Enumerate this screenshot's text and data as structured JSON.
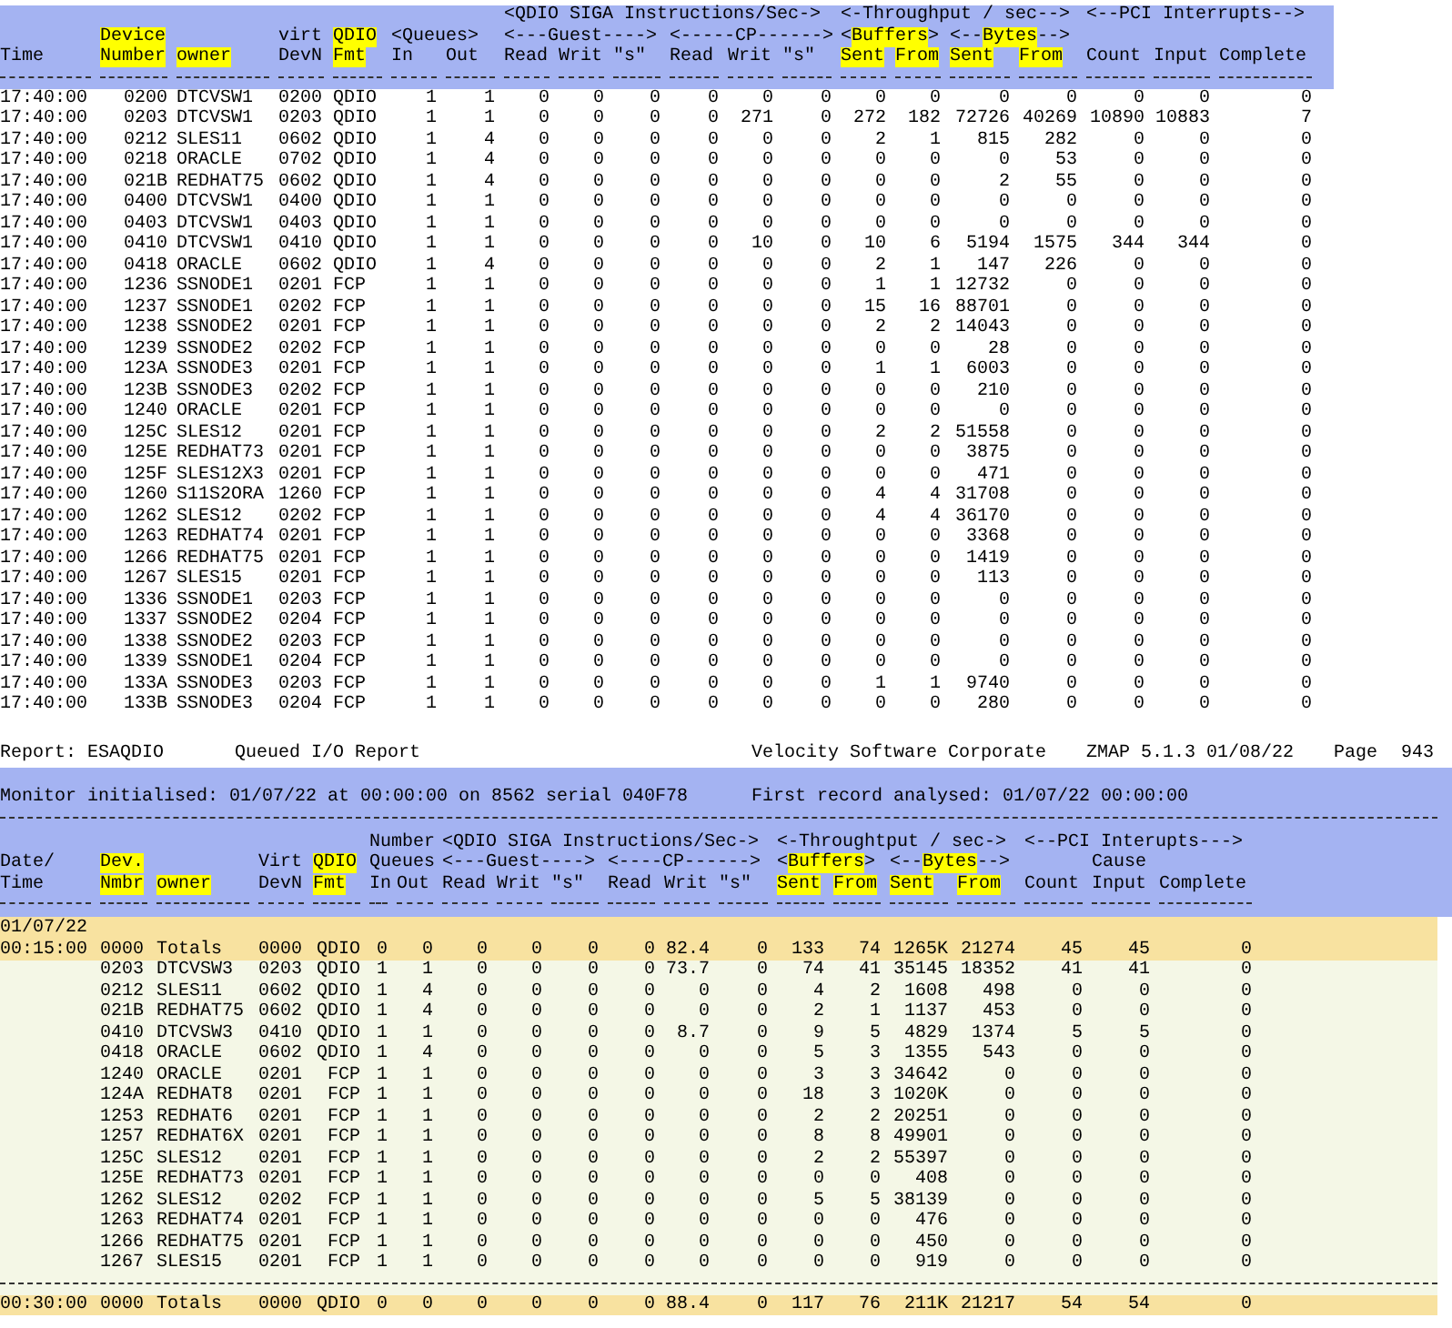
{
  "top_table": {
    "header_rows": [
      [
        {
          "text": "<QDIO SIGA Instructions/Sec->",
          "highlight": false
        },
        {
          "text": "<-Throughput / sec-->",
          "highlight": false
        },
        {
          "text": "<--PCI Interrupts-->",
          "highlight": false
        }
      ],
      [
        {
          "text": "Device",
          "highlight": true
        },
        {
          "text": "virt",
          "highlight": false
        },
        {
          "text": "QDIO",
          "highlight": true
        },
        {
          "text": "<Queues>",
          "highlight": false
        },
        {
          "text": "<---Guest---->",
          "highlight": false
        },
        {
          "text": "<-----CP------>",
          "highlight": false
        },
        {
          "parts": [
            {
              "text": "<",
              "highlight": false
            },
            {
              "text": "Buffers",
              "highlight": true
            },
            {
              "text": ">",
              "highlight": false
            }
          ]
        },
        {
          "parts": [
            {
              "text": "<--",
              "highlight": false
            },
            {
              "text": "Bytes",
              "highlight": true
            },
            {
              "text": "-->",
              "highlight": false
            }
          ]
        }
      ],
      [
        {
          "text": "Time",
          "highlight": false
        },
        {
          "text": "Number",
          "highlight": true
        },
        {
          "text": "owner",
          "highlight": true
        },
        {
          "text": "DevN",
          "highlight": false
        },
        {
          "text": "Fmt",
          "highlight": true
        },
        {
          "text": "In",
          "highlight": false
        },
        {
          "text": "Out",
          "highlight": false
        },
        {
          "text": "Read",
          "highlight": false
        },
        {
          "text": "Writ",
          "highlight": false
        },
        {
          "text": "\"s\"",
          "highlight": false
        },
        {
          "text": "Read",
          "highlight": false
        },
        {
          "text": "Writ",
          "highlight": false
        },
        {
          "text": "\"s\"",
          "highlight": false
        },
        {
          "text": "Sent",
          "highlight": true
        },
        {
          "text": "From",
          "highlight": true
        },
        {
          "text": "Sent",
          "highlight": true
        },
        {
          "text": "From",
          "highlight": true
        },
        {
          "text": "Count",
          "highlight": false
        },
        {
          "text": "Input",
          "highlight": false
        },
        {
          "text": "Complete",
          "highlight": false
        }
      ]
    ],
    "rows": [
      [
        "17:40:00",
        "0200",
        "DTCVSW1",
        "0200",
        "QDIO",
        "1",
        "1",
        "0",
        "0",
        "0",
        "0",
        "0",
        "0",
        "0",
        "0",
        "0",
        "0",
        "0",
        "0",
        "0"
      ],
      [
        "17:40:00",
        "0203",
        "DTCVSW1",
        "0203",
        "QDIO",
        "1",
        "1",
        "0",
        "0",
        "0",
        "0",
        "271",
        "0",
        "272",
        "182",
        "72726",
        "40269",
        "10890",
        "10883",
        "7"
      ],
      [
        "17:40:00",
        "0212",
        "SLES11",
        "0602",
        "QDIO",
        "1",
        "4",
        "0",
        "0",
        "0",
        "0",
        "0",
        "0",
        "2",
        "1",
        "815",
        "282",
        "0",
        "0",
        "0"
      ],
      [
        "17:40:00",
        "0218",
        "ORACLE",
        "0702",
        "QDIO",
        "1",
        "4",
        "0",
        "0",
        "0",
        "0",
        "0",
        "0",
        "0",
        "0",
        "0",
        "53",
        "0",
        "0",
        "0"
      ],
      [
        "17:40:00",
        "021B",
        "REDHAT75",
        "0602",
        "QDIO",
        "1",
        "4",
        "0",
        "0",
        "0",
        "0",
        "0",
        "0",
        "0",
        "0",
        "2",
        "55",
        "0",
        "0",
        "0"
      ],
      [
        "17:40:00",
        "0400",
        "DTCVSW1",
        "0400",
        "QDIO",
        "1",
        "1",
        "0",
        "0",
        "0",
        "0",
        "0",
        "0",
        "0",
        "0",
        "0",
        "0",
        "0",
        "0",
        "0"
      ],
      [
        "17:40:00",
        "0403",
        "DTCVSW1",
        "0403",
        "QDIO",
        "1",
        "1",
        "0",
        "0",
        "0",
        "0",
        "0",
        "0",
        "0",
        "0",
        "0",
        "0",
        "0",
        "0",
        "0"
      ],
      [
        "17:40:00",
        "0410",
        "DTCVSW1",
        "0410",
        "QDIO",
        "1",
        "1",
        "0",
        "0",
        "0",
        "0",
        "10",
        "0",
        "10",
        "6",
        "5194",
        "1575",
        "344",
        "344",
        "0"
      ],
      [
        "17:40:00",
        "0418",
        "ORACLE",
        "0602",
        "QDIO",
        "1",
        "4",
        "0",
        "0",
        "0",
        "0",
        "0",
        "0",
        "2",
        "1",
        "147",
        "226",
        "0",
        "0",
        "0"
      ],
      [
        "17:40:00",
        "1236",
        "SSNODE1",
        "0201",
        "FCP",
        "1",
        "1",
        "0",
        "0",
        "0",
        "0",
        "0",
        "0",
        "1",
        "1",
        "12732",
        "0",
        "0",
        "0",
        "0"
      ],
      [
        "17:40:00",
        "1237",
        "SSNODE1",
        "0202",
        "FCP",
        "1",
        "1",
        "0",
        "0",
        "0",
        "0",
        "0",
        "0",
        "15",
        "16",
        "88701",
        "0",
        "0",
        "0",
        "0"
      ],
      [
        "17:40:00",
        "1238",
        "SSNODE2",
        "0201",
        "FCP",
        "1",
        "1",
        "0",
        "0",
        "0",
        "0",
        "0",
        "0",
        "2",
        "2",
        "14043",
        "0",
        "0",
        "0",
        "0"
      ],
      [
        "17:40:00",
        "1239",
        "SSNODE2",
        "0202",
        "FCP",
        "1",
        "1",
        "0",
        "0",
        "0",
        "0",
        "0",
        "0",
        "0",
        "0",
        "28",
        "0",
        "0",
        "0",
        "0"
      ],
      [
        "17:40:00",
        "123A",
        "SSNODE3",
        "0201",
        "FCP",
        "1",
        "1",
        "0",
        "0",
        "0",
        "0",
        "0",
        "0",
        "1",
        "1",
        "6003",
        "0",
        "0",
        "0",
        "0"
      ],
      [
        "17:40:00",
        "123B",
        "SSNODE3",
        "0202",
        "FCP",
        "1",
        "1",
        "0",
        "0",
        "0",
        "0",
        "0",
        "0",
        "0",
        "0",
        "210",
        "0",
        "0",
        "0",
        "0"
      ],
      [
        "17:40:00",
        "1240",
        "ORACLE",
        "0201",
        "FCP",
        "1",
        "1",
        "0",
        "0",
        "0",
        "0",
        "0",
        "0",
        "0",
        "0",
        "0",
        "0",
        "0",
        "0",
        "0"
      ],
      [
        "17:40:00",
        "125C",
        "SLES12",
        "0201",
        "FCP",
        "1",
        "1",
        "0",
        "0",
        "0",
        "0",
        "0",
        "0",
        "2",
        "2",
        "51558",
        "0",
        "0",
        "0",
        "0"
      ],
      [
        "17:40:00",
        "125E",
        "REDHAT73",
        "0201",
        "FCP",
        "1",
        "1",
        "0",
        "0",
        "0",
        "0",
        "0",
        "0",
        "0",
        "0",
        "3875",
        "0",
        "0",
        "0",
        "0"
      ],
      [
        "17:40:00",
        "125F",
        "SLES12X3",
        "0201",
        "FCP",
        "1",
        "1",
        "0",
        "0",
        "0",
        "0",
        "0",
        "0",
        "0",
        "0",
        "471",
        "0",
        "0",
        "0",
        "0"
      ],
      [
        "17:40:00",
        "1260",
        "S11S2ORA",
        "1260",
        "FCP",
        "1",
        "1",
        "0",
        "0",
        "0",
        "0",
        "0",
        "0",
        "4",
        "4",
        "31708",
        "0",
        "0",
        "0",
        "0"
      ],
      [
        "17:40:00",
        "1262",
        "SLES12",
        "0202",
        "FCP",
        "1",
        "1",
        "0",
        "0",
        "0",
        "0",
        "0",
        "0",
        "4",
        "4",
        "36170",
        "0",
        "0",
        "0",
        "0"
      ],
      [
        "17:40:00",
        "1263",
        "REDHAT74",
        "0201",
        "FCP",
        "1",
        "1",
        "0",
        "0",
        "0",
        "0",
        "0",
        "0",
        "0",
        "0",
        "3368",
        "0",
        "0",
        "0",
        "0"
      ],
      [
        "17:40:00",
        "1266",
        "REDHAT75",
        "0201",
        "FCP",
        "1",
        "1",
        "0",
        "0",
        "0",
        "0",
        "0",
        "0",
        "0",
        "0",
        "1419",
        "0",
        "0",
        "0",
        "0"
      ],
      [
        "17:40:00",
        "1267",
        "SLES15",
        "0201",
        "FCP",
        "1",
        "1",
        "0",
        "0",
        "0",
        "0",
        "0",
        "0",
        "0",
        "0",
        "113",
        "0",
        "0",
        "0",
        "0"
      ],
      [
        "17:40:00",
        "1336",
        "SSNODE1",
        "0203",
        "FCP",
        "1",
        "1",
        "0",
        "0",
        "0",
        "0",
        "0",
        "0",
        "0",
        "0",
        "0",
        "0",
        "0",
        "0",
        "0"
      ],
      [
        "17:40:00",
        "1337",
        "SSNODE2",
        "0204",
        "FCP",
        "1",
        "1",
        "0",
        "0",
        "0",
        "0",
        "0",
        "0",
        "0",
        "0",
        "0",
        "0",
        "0",
        "0",
        "0"
      ],
      [
        "17:40:00",
        "1338",
        "SSNODE2",
        "0203",
        "FCP",
        "1",
        "1",
        "0",
        "0",
        "0",
        "0",
        "0",
        "0",
        "0",
        "0",
        "0",
        "0",
        "0",
        "0",
        "0"
      ],
      [
        "17:40:00",
        "1339",
        "SSNODE1",
        "0204",
        "FCP",
        "1",
        "1",
        "0",
        "0",
        "0",
        "0",
        "0",
        "0",
        "0",
        "0",
        "0",
        "0",
        "0",
        "0",
        "0"
      ],
      [
        "17:40:00",
        "133A",
        "SSNODE3",
        "0203",
        "FCP",
        "1",
        "1",
        "0",
        "0",
        "0",
        "0",
        "0",
        "0",
        "1",
        "1",
        "9740",
        "0",
        "0",
        "0",
        "0"
      ],
      [
        "17:40:00",
        "133B",
        "SSNODE3",
        "0204",
        "FCP",
        "1",
        "1",
        "0",
        "0",
        "0",
        "0",
        "0",
        "0",
        "0",
        "0",
        "280",
        "0",
        "0",
        "0",
        "0"
      ]
    ]
  },
  "report_line": {
    "report": "Report: ESAQDIO",
    "title": "Queued I/O Report",
    "company": "Velocity Software Corporate",
    "version": "ZMAP 5.1.3 01/08/22",
    "page_label": "Page",
    "page": "943"
  },
  "bottom_table": {
    "monitor": "Monitor initialised: 01/07/22 at 00:00:00 on 8562 serial 040F78",
    "first_record": "First record analysed: 01/07/22 00:00:00",
    "header_rows": [
      [
        {
          "text": "Number",
          "highlight": false
        },
        {
          "text": "<QDIO SIGA Instructions/Sec->",
          "highlight": false
        },
        {
          "text": "<-Throughtput / sec->",
          "highlight": false
        },
        {
          "text": "<--PCI Interupts--->",
          "highlight": false
        }
      ],
      [
        {
          "text": "Date/",
          "highlight": false
        },
        {
          "text": "Dev.",
          "highlight": true
        },
        {
          "text": "Virt",
          "highlight": false
        },
        {
          "text": "QDIO",
          "highlight": true
        },
        {
          "text": "Queues",
          "highlight": false
        },
        {
          "text": "<---Guest---->",
          "highlight": false
        },
        {
          "text": "<----CP------>",
          "highlight": false
        },
        {
          "parts": [
            {
              "text": "<",
              "highlight": false
            },
            {
              "text": "Buffers",
              "highlight": true
            },
            {
              "text": ">",
              "highlight": false
            }
          ]
        },
        {
          "parts": [
            {
              "text": "<--",
              "highlight": false
            },
            {
              "text": "Bytes",
              "highlight": true
            },
            {
              "text": "-->",
              "highlight": false
            }
          ]
        },
        {
          "text": "Cause",
          "highlight": false
        }
      ],
      [
        {
          "text": "Time",
          "highlight": false
        },
        {
          "text": "Nmbr",
          "highlight": true
        },
        {
          "text": "owner",
          "highlight": true
        },
        {
          "text": "DevN",
          "highlight": false
        },
        {
          "text": "Fmt",
          "highlight": true
        },
        {
          "text": "In",
          "highlight": false
        },
        {
          "text": "Out",
          "highlight": false
        },
        {
          "text": "Read",
          "highlight": false
        },
        {
          "text": "Writ",
          "highlight": false
        },
        {
          "text": "\"s\"",
          "highlight": false
        },
        {
          "text": "Read",
          "highlight": false
        },
        {
          "text": "Writ",
          "highlight": false
        },
        {
          "text": "\"s\"",
          "highlight": false
        },
        {
          "text": "Sent",
          "highlight": true
        },
        {
          "text": "From",
          "highlight": true
        },
        {
          "text": "Sent",
          "highlight": true
        },
        {
          "text": "From",
          "highlight": true
        },
        {
          "text": "Count",
          "highlight": false
        },
        {
          "text": "Input",
          "highlight": false
        },
        {
          "text": "Complete",
          "highlight": false
        }
      ]
    ],
    "rows": [
      {
        "kind": "date",
        "date": "01/07/22"
      },
      {
        "kind": "total",
        "time": "00:15:00",
        "cells": [
          "0000",
          "Totals",
          "0000",
          "QDIO",
          "0",
          "0",
          "0",
          "0",
          "0",
          "0",
          "82.4",
          "0",
          "133",
          "74",
          "1265K",
          "21274",
          "45",
          "45",
          "0"
        ]
      },
      {
        "kind": "detail",
        "cells": [
          "0203",
          "DTCVSW3",
          "0203",
          "QDIO",
          "1",
          "1",
          "0",
          "0",
          "0",
          "0",
          "73.7",
          "0",
          "74",
          "41",
          "35145",
          "18352",
          "41",
          "41",
          "0"
        ]
      },
      {
        "kind": "detail",
        "cells": [
          "0212",
          "SLES11",
          "0602",
          "QDIO",
          "1",
          "4",
          "0",
          "0",
          "0",
          "0",
          "0",
          "0",
          "4",
          "2",
          "1608",
          "498",
          "0",
          "0",
          "0"
        ]
      },
      {
        "kind": "detail",
        "cells": [
          "021B",
          "REDHAT75",
          "0602",
          "QDIO",
          "1",
          "4",
          "0",
          "0",
          "0",
          "0",
          "0",
          "0",
          "2",
          "1",
          "1137",
          "453",
          "0",
          "0",
          "0"
        ]
      },
      {
        "kind": "detail",
        "cells": [
          "0410",
          "DTCVSW3",
          "0410",
          "QDIO",
          "1",
          "1",
          "0",
          "0",
          "0",
          "0",
          "8.7",
          "0",
          "9",
          "5",
          "4829",
          "1374",
          "5",
          "5",
          "0"
        ]
      },
      {
        "kind": "detail",
        "cells": [
          "0418",
          "ORACLE",
          "0602",
          "QDIO",
          "1",
          "4",
          "0",
          "0",
          "0",
          "0",
          "0",
          "0",
          "5",
          "3",
          "1355",
          "543",
          "0",
          "0",
          "0"
        ]
      },
      {
        "kind": "detail",
        "cells": [
          "1240",
          "ORACLE",
          "0201",
          "FCP",
          "1",
          "1",
          "0",
          "0",
          "0",
          "0",
          "0",
          "0",
          "3",
          "3",
          "34642",
          "0",
          "0",
          "0",
          "0"
        ]
      },
      {
        "kind": "detail",
        "cells": [
          "124A",
          "REDHAT8",
          "0201",
          "FCP",
          "1",
          "1",
          "0",
          "0",
          "0",
          "0",
          "0",
          "0",
          "18",
          "3",
          "1020K",
          "0",
          "0",
          "0",
          "0"
        ]
      },
      {
        "kind": "detail",
        "cells": [
          "1253",
          "REDHAT6",
          "0201",
          "FCP",
          "1",
          "1",
          "0",
          "0",
          "0",
          "0",
          "0",
          "0",
          "2",
          "2",
          "20251",
          "0",
          "0",
          "0",
          "0"
        ]
      },
      {
        "kind": "detail",
        "cells": [
          "1257",
          "REDHAT6X",
          "0201",
          "FCP",
          "1",
          "1",
          "0",
          "0",
          "0",
          "0",
          "0",
          "0",
          "8",
          "8",
          "49901",
          "0",
          "0",
          "0",
          "0"
        ]
      },
      {
        "kind": "detail",
        "cells": [
          "125C",
          "SLES12",
          "0201",
          "FCP",
          "1",
          "1",
          "0",
          "0",
          "0",
          "0",
          "0",
          "0",
          "2",
          "2",
          "55397",
          "0",
          "0",
          "0",
          "0"
        ]
      },
      {
        "kind": "detail",
        "cells": [
          "125E",
          "REDHAT73",
          "0201",
          "FCP",
          "1",
          "1",
          "0",
          "0",
          "0",
          "0",
          "0",
          "0",
          "0",
          "0",
          "408",
          "0",
          "0",
          "0",
          "0"
        ]
      },
      {
        "kind": "detail",
        "cells": [
          "1262",
          "SLES12",
          "0202",
          "FCP",
          "1",
          "1",
          "0",
          "0",
          "0",
          "0",
          "0",
          "0",
          "5",
          "5",
          "38139",
          "0",
          "0",
          "0",
          "0"
        ]
      },
      {
        "kind": "detail",
        "cells": [
          "1263",
          "REDHAT74",
          "0201",
          "FCP",
          "1",
          "1",
          "0",
          "0",
          "0",
          "0",
          "0",
          "0",
          "0",
          "0",
          "476",
          "0",
          "0",
          "0",
          "0"
        ]
      },
      {
        "kind": "detail",
        "cells": [
          "1266",
          "REDHAT75",
          "0201",
          "FCP",
          "1",
          "1",
          "0",
          "0",
          "0",
          "0",
          "0",
          "0",
          "0",
          "0",
          "450",
          "0",
          "0",
          "0",
          "0"
        ]
      },
      {
        "kind": "detail",
        "cells": [
          "1267",
          "SLES15",
          "0201",
          "FCP",
          "1",
          "1",
          "0",
          "0",
          "0",
          "0",
          "0",
          "0",
          "0",
          "0",
          "919",
          "0",
          "0",
          "0",
          "0"
        ]
      },
      {
        "kind": "separator"
      },
      {
        "kind": "total",
        "time": "00:30:00",
        "cells": [
          "0000",
          "Totals",
          "0000",
          "QDIO",
          "0",
          "0",
          "0",
          "0",
          "0",
          "0",
          "88.4",
          "0",
          "117",
          "76",
          "211K",
          "21217",
          "54",
          "54",
          "0"
        ]
      }
    ]
  }
}
